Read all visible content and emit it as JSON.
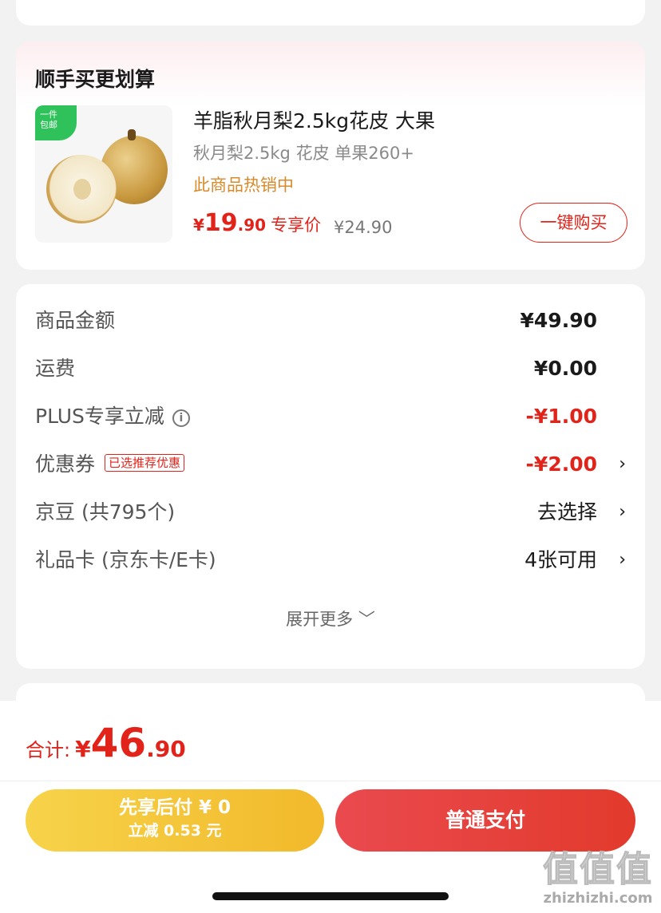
{
  "bundle": {
    "title": "顺手买更划算",
    "product": {
      "ship_tag_line1": "一件",
      "ship_tag_line2": "包邮",
      "name": "羊脂秋月梨2.5kg花皮 大果",
      "spec": "秋月梨2.5kg 花皮 单果260+",
      "hot": "此商品热销中",
      "price_symbol": "¥",
      "price_int": "19",
      "price_dec": ".90",
      "price_label": "专享价",
      "original_price": "¥24.90",
      "buy_label": "一键购买"
    }
  },
  "summary": {
    "rows": [
      {
        "label": "商品金额",
        "value": "¥49.90"
      },
      {
        "label": "运费",
        "value": "¥0.00"
      },
      {
        "label": "PLUS专享立减",
        "info_icon": "info-icon",
        "value": "-¥1.00"
      },
      {
        "label": "优惠券",
        "tag": "已选推荐优惠",
        "value": "-¥2.00",
        "chevron": "›"
      },
      {
        "label": "京豆 (共795个)",
        "value": "去选择",
        "chevron": "›"
      },
      {
        "label": "礼品卡 (京东卡/E卡)",
        "value": "4张可用",
        "chevron": "›"
      }
    ],
    "expand_label": "展开更多 ﹀"
  },
  "footer": {
    "total_label": "合计:",
    "total_symbol": "¥",
    "total_int": "46",
    "total_dec": ".90",
    "pay_later_line1": "先享后付 ¥ 0",
    "pay_later_line2": "立减 0.53 元",
    "pay_normal": "普通支付"
  },
  "watermark": {
    "big": "值值值",
    "small": "zhizhizhi.com"
  },
  "colors": {
    "accent_red": "#e2231a",
    "hot_orange": "#d98a2b",
    "pay_later_yellow": "#f2b92b",
    "ship_green": "#2fc25b"
  }
}
